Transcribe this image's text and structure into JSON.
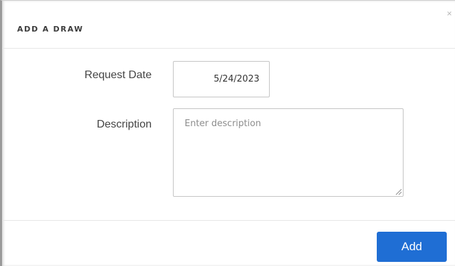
{
  "modal": {
    "title": "ADD A DRAW",
    "close_glyph": "×",
    "close_icon": "close-icon"
  },
  "form": {
    "request_date": {
      "label": "Request Date",
      "value": "5/24/2023"
    },
    "description": {
      "label": "Description",
      "value": "",
      "placeholder": "Enter description"
    }
  },
  "footer": {
    "add_label": "Add"
  },
  "colors": {
    "primary_button": "#1f6ed4",
    "title_text": "#3b3b3b",
    "label_text": "#444444",
    "border": "#c4c4c4"
  }
}
